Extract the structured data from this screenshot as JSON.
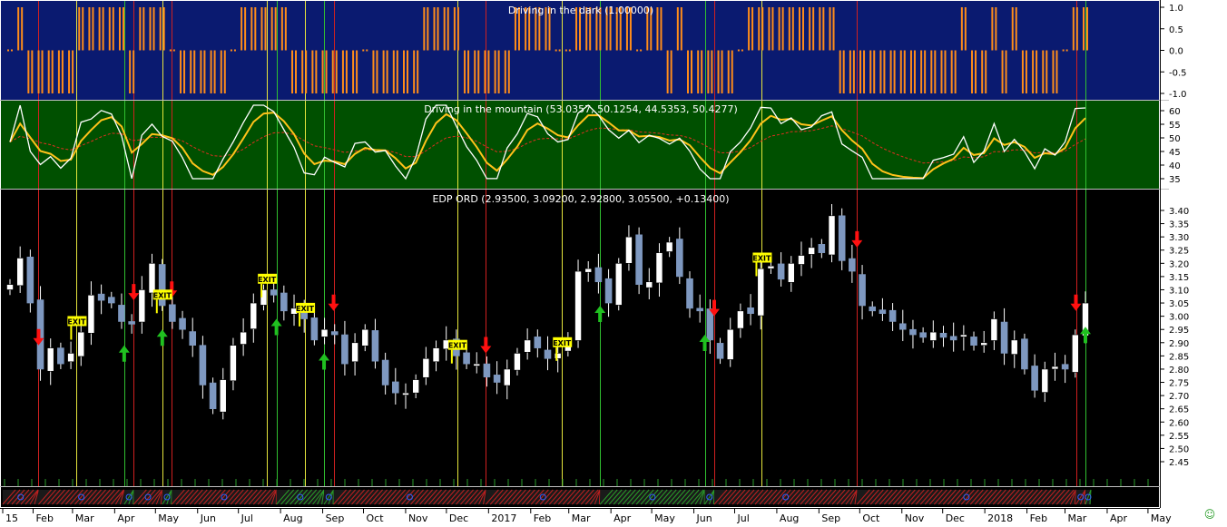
{
  "panels": {
    "dark": {
      "title": "Driving in the dark (1.00000)",
      "bg": "#0a1a70",
      "bar_color": "#ff8c1a",
      "ylim": [
        -1.1,
        1.1
      ],
      "ticks": [
        "1.0",
        "0.5",
        "0.0",
        "-0.5",
        "-1.0"
      ],
      "tick_values": [
        1.0,
        0.5,
        0.0,
        -0.5,
        -1.0
      ]
    },
    "mountain": {
      "title": "Driving in the mountain (53.0357, 50.1254, 44.5353, 50.4277)",
      "bg": "#005000",
      "ylim": [
        32,
        63
      ],
      "ticks": [
        "60",
        "55",
        "50",
        "45",
        "40",
        "35"
      ],
      "tick_values": [
        60,
        55,
        50,
        45,
        40,
        35
      ],
      "line_colors": {
        "white": "#ffffff",
        "yellow": "#ffc21a",
        "red": "#e03020"
      }
    },
    "price": {
      "title": "EDP ORD (2.93500, 3.09200, 2.92800, 3.05500, +0.13400)",
      "bg": "#000000",
      "ylim": [
        2.4,
        3.45
      ],
      "ticks": [
        "3.40",
        "3.35",
        "3.30",
        "3.25",
        "3.20",
        "3.15",
        "3.10",
        "3.05",
        "3.00",
        "2.95",
        "2.90",
        "2.85",
        "2.80",
        "2.75",
        "2.70",
        "2.65",
        "2.60",
        "2.55",
        "2.50",
        "2.45"
      ],
      "tick_values": [
        3.4,
        3.35,
        3.3,
        3.25,
        3.2,
        3.15,
        3.1,
        3.05,
        3.0,
        2.95,
        2.9,
        2.85,
        2.8,
        2.75,
        2.7,
        2.65,
        2.6,
        2.55,
        2.5,
        2.45
      ],
      "bull_color": "#ffffff",
      "bear_color": "#7e98c0",
      "exit_label": "EXIT"
    }
  },
  "x_axis": {
    "labels": [
      "15",
      "Feb",
      "Mar",
      "Apr",
      "May",
      "Jun",
      "Jul",
      "Aug",
      "Sep",
      "Oct",
      "Nov",
      "Dec",
      "2017",
      "Feb",
      "Mar",
      "Apr",
      "May",
      "Jun",
      "Jul",
      "Aug",
      "Sep",
      "Oct",
      "Nov",
      "Dec",
      "2018",
      "Feb",
      "Mar",
      "Apr",
      "May"
    ]
  },
  "colors": {
    "vline_red": "#d02020",
    "vline_yellow": "#e6e63c",
    "vline_green": "#30c030",
    "arrow_red": "#ff1010",
    "arrow_green": "#20c020",
    "exit_bg": "#ffff00",
    "axis_text": "#000000"
  },
  "chart_data": {
    "type": "candlestick",
    "title": "EDP ORD (2.93500, 3.09200, 2.92800, 3.05500, +0.13400)",
    "ylim": [
      2.4,
      3.45
    ],
    "x_start": "2016-01-15",
    "x_end": "2018-03-16",
    "weekly_close": [
      3.12,
      3.22,
      3.05,
      2.8,
      2.88,
      2.82,
      2.86,
      2.94,
      3.08,
      3.06,
      3.05,
      2.98,
      2.97,
      3.1,
      3.2,
      3.04,
      2.98,
      2.95,
      2.89,
      2.74,
      2.65,
      2.76,
      2.89,
      2.94,
      3.05,
      3.1,
      3.08,
      3.02,
      3.03,
      2.99,
      2.91,
      2.95,
      2.93,
      2.82,
      2.9,
      2.95,
      2.83,
      2.74,
      2.71,
      2.71,
      2.76,
      2.84,
      2.88,
      2.91,
      2.85,
      2.82,
      2.82,
      2.77,
      2.75,
      2.8,
      2.86,
      2.91,
      2.88,
      2.84,
      2.86,
      2.92,
      3.17,
      3.18,
      3.13,
      3.05,
      3.2,
      3.3,
      3.12,
      3.13,
      3.24,
      3.28,
      3.15,
      3.03,
      3.02,
      2.91,
      2.84,
      2.95,
      3.02,
      3.01,
      3.18,
      3.19,
      3.14,
      3.2,
      3.23,
      3.26,
      3.24,
      3.38,
      3.21,
      3.17,
      3.04,
      3.02,
      3.01,
      2.98,
      2.95,
      2.93,
      2.92,
      2.94,
      2.92,
      2.91,
      2.93,
      2.89,
      2.9,
      2.99,
      2.86,
      2.91,
      2.8,
      2.72,
      2.8,
      2.81,
      2.8,
      2.93,
      3.05
    ],
    "signals": {
      "sell_arrows": [
        "2016-02-05",
        "2016-04-15",
        "2016-05-13",
        "2016-09-09",
        "2016-12-30",
        "2017-06-16",
        "2017-09-29",
        "2018-03-09"
      ],
      "buy_arrows": [
        "2016-04-08",
        "2016-05-06",
        "2016-07-29",
        "2016-09-02",
        "2017-03-24",
        "2017-06-09",
        "2018-03-16"
      ],
      "exits": [
        "2016-03-04",
        "2016-05-06",
        "2016-07-22",
        "2016-08-19",
        "2016-12-09",
        "2017-02-24",
        "2017-07-21"
      ]
    }
  }
}
